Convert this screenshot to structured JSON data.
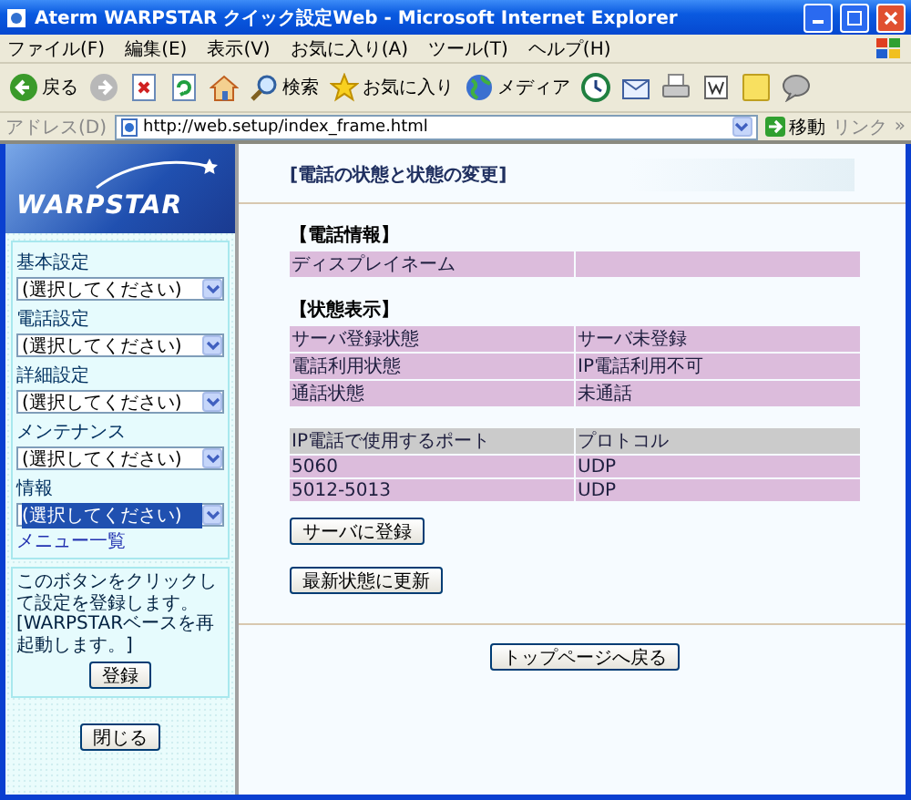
{
  "window": {
    "title": "Aterm WARPSTAR クイック設定Web - Microsoft Internet Explorer"
  },
  "menu": [
    "ファイル(F)",
    "編集(E)",
    "表示(V)",
    "お気に入り(A)",
    "ツール(T)",
    "ヘルプ(H)"
  ],
  "toolbar": [
    {
      "kind": "back",
      "label": "戻る"
    },
    {
      "kind": "forward"
    },
    {
      "kind": "stop"
    },
    {
      "kind": "refresh"
    },
    {
      "kind": "home"
    },
    {
      "kind": "search",
      "label": "検索"
    },
    {
      "kind": "favorites",
      "label": "お気に入り"
    },
    {
      "kind": "media",
      "label": "メディア"
    },
    {
      "kind": "history"
    },
    {
      "kind": "mail"
    },
    {
      "kind": "print"
    },
    {
      "kind": "edit"
    },
    {
      "kind": "notes"
    },
    {
      "kind": "messenger"
    }
  ],
  "address": {
    "label": "アドレス(D)",
    "value": "http://web.setup/index_frame.html",
    "go": "移動",
    "links": "リンク",
    "more": "»"
  },
  "sidebar": {
    "logo": "WARPSTAR",
    "groups": [
      {
        "label": "基本設定",
        "value": "(選択してください)",
        "focused": false
      },
      {
        "label": "電話設定",
        "value": "(選択してください)",
        "focused": false
      },
      {
        "label": "詳細設定",
        "value": "(選択してください)",
        "focused": false
      },
      {
        "label": "メンテナンス",
        "value": "(選択してください)",
        "focused": false
      },
      {
        "label": "情報",
        "value": "(選択してください)",
        "focused": true
      }
    ],
    "menu_link": "メニュー一覧",
    "note": "このボタンをクリックして設定を登録します。[WARPSTARベースを再起動します。]",
    "register_button": "登録",
    "close_button": "閉じる"
  },
  "main": {
    "title": "[電話の状態と状態の変更]",
    "phone_info": {
      "heading": "【電話情報】",
      "rows": [
        {
          "label": "ディスプレイネーム"
        }
      ]
    },
    "status": {
      "heading": "【状態表示】",
      "rows": [
        {
          "label": "サーバ登録状態",
          "value": "サーバ未登録"
        },
        {
          "label": "電話利用状態",
          "value": "IP電話利用不可"
        },
        {
          "label": "通話状態",
          "value": "未通話"
        }
      ]
    },
    "ports": {
      "columns": [
        "IP電話で使用するポート",
        "プロトコル"
      ],
      "rows": [
        [
          "5060",
          "UDP"
        ],
        [
          "5012-5013",
          "UDP"
        ]
      ]
    },
    "buttons": [
      "サーバに登録",
      "最新状態に更新"
    ],
    "top_button": "トップページへ戻る"
  }
}
